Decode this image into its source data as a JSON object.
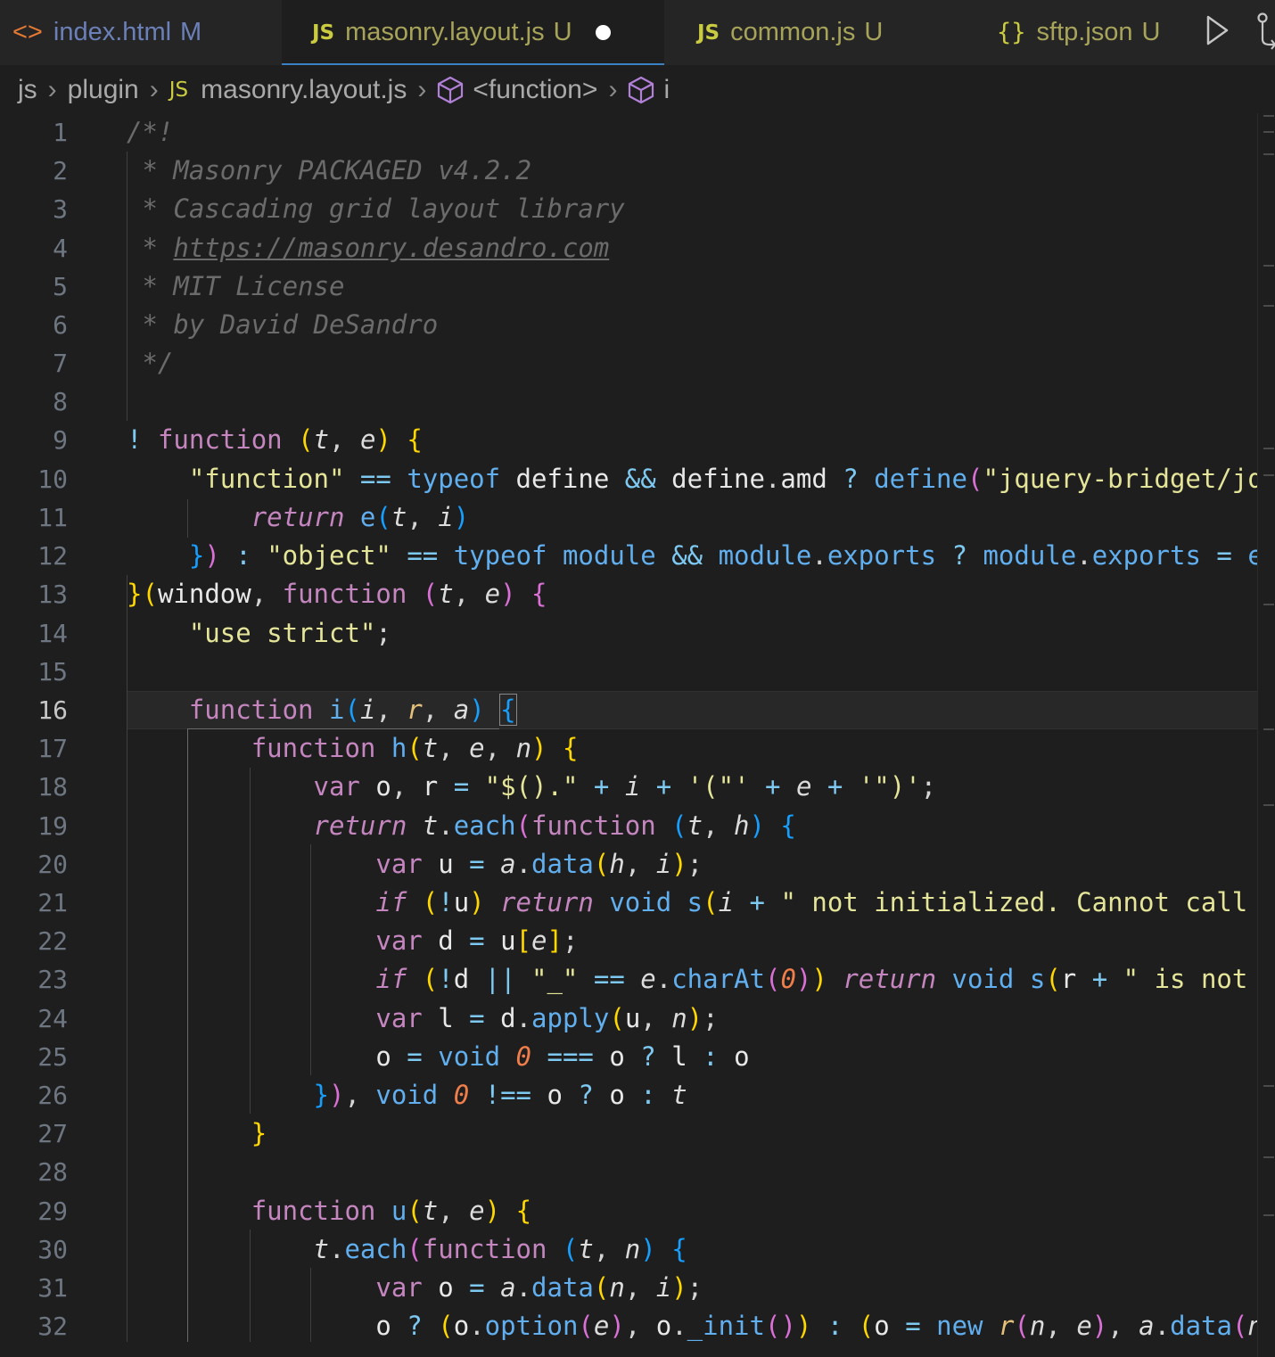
{
  "tabs": [
    {
      "icon": "<>",
      "name": "index.html",
      "status": "M"
    },
    {
      "icon": "JS",
      "name": "masonry.layout.js",
      "status": "U"
    },
    {
      "icon": "JS",
      "name": "common.js",
      "status": "U"
    },
    {
      "icon": "{}",
      "name": "sftp.json",
      "status": "U"
    }
  ],
  "breadcrumb": {
    "folder1": "js",
    "folder2": "plugin",
    "file_icon": "JS",
    "file": "masonry.layout.js",
    "symbol1": "<function>",
    "symbol2": "i"
  },
  "editor": {
    "current_line": 16,
    "line_numbers": [
      "1",
      "2",
      "3",
      "4",
      "5",
      "6",
      "7",
      "8",
      "9",
      "10",
      "11",
      "12",
      "13",
      "14",
      "15",
      "16",
      "17",
      "18",
      "19",
      "20",
      "21",
      "22",
      "23",
      "24",
      "25",
      "26",
      "27",
      "28",
      "29",
      "30",
      "31",
      "32"
    ]
  },
  "icons": {
    "html_tab": "angle-brackets-icon",
    "js_tab": "js-file-icon",
    "json_tab": "json-braces-icon",
    "run": "play-icon",
    "source_control": "git-compare-icon",
    "symbol": "cube-symbol-icon"
  },
  "colors": {
    "background": "#1e1e1e",
    "tab_bar": "#252526",
    "active_tab_border": "#3b82c4",
    "keyword": "#c586c0",
    "function": "#61afef",
    "string": "#e5e59a",
    "comment": "#6b6b6b"
  }
}
